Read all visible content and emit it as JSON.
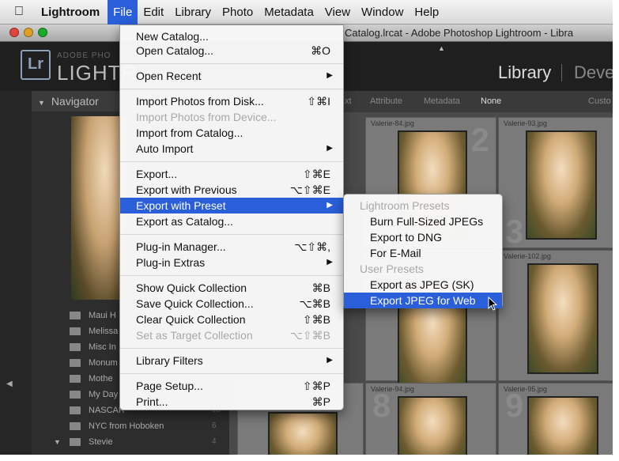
{
  "menubar": {
    "app": "Lightroom",
    "items": [
      "File",
      "Edit",
      "Library",
      "Photo",
      "Metadata",
      "View",
      "Window",
      "Help"
    ],
    "active": "File"
  },
  "window": {
    "title": "Catalog.lrcat - Adobe Photoshop Lightroom - Libra",
    "logo_text": "Lr",
    "adobe_text": "ADOBE PHO",
    "product_text": "LIGHTR",
    "modules": [
      "Library",
      "Deve"
    ]
  },
  "navigator": {
    "title": "Navigator"
  },
  "filterbar": {
    "items": [
      "xt",
      "Attribute",
      "Metadata",
      "None",
      "Custo"
    ]
  },
  "collections": [
    {
      "name": "Maui H",
      "count": ""
    },
    {
      "name": "Melissa",
      "count": ""
    },
    {
      "name": "Misc In",
      "count": ""
    },
    {
      "name": "Monum",
      "count": ""
    },
    {
      "name": "Mothe",
      "count": ""
    },
    {
      "name": "My Day",
      "count": ""
    },
    {
      "name": "NASCAR",
      "count": "15"
    },
    {
      "name": "NYC from Hoboken",
      "count": "6"
    },
    {
      "name": "Stevie",
      "count": "4"
    }
  ],
  "grid": {
    "labels": [
      "Valerie-84.jpg",
      "Valerie-93.jpg",
      "Valerie-102.jpg",
      "Valerie-94.jpg",
      "Valerie-95.jpg"
    ],
    "numbers": [
      "2",
      "3",
      "8",
      "9"
    ]
  },
  "file_menu": {
    "items": [
      {
        "label": "New Catalog...",
        "shortcut": ""
      },
      {
        "label": "Open Catalog...",
        "shortcut": "⌘O"
      },
      {
        "label": "Open Recent",
        "shortcut": ""
      },
      {
        "label": "Import Photos from Disk...",
        "shortcut": "⇧⌘I"
      },
      {
        "label": "Import Photos from Device...",
        "shortcut": ""
      },
      {
        "label": "Import from Catalog...",
        "shortcut": ""
      },
      {
        "label": "Auto Import",
        "shortcut": ""
      },
      {
        "label": "Export...",
        "shortcut": "⇧⌘E"
      },
      {
        "label": "Export with Previous",
        "shortcut": "⌥⇧⌘E"
      },
      {
        "label": "Export with Preset",
        "shortcut": ""
      },
      {
        "label": "Export as Catalog...",
        "shortcut": ""
      },
      {
        "label": "Plug-in Manager...",
        "shortcut": "⌥⇧⌘,"
      },
      {
        "label": "Plug-in Extras",
        "shortcut": ""
      },
      {
        "label": "Show Quick Collection",
        "shortcut": "⌘B"
      },
      {
        "label": "Save Quick Collection...",
        "shortcut": "⌥⌘B"
      },
      {
        "label": "Clear Quick Collection",
        "shortcut": "⇧⌘B"
      },
      {
        "label": "Set as Target Collection",
        "shortcut": "⌥⇧⌘B"
      },
      {
        "label": "Library Filters",
        "shortcut": ""
      },
      {
        "label": "Page Setup...",
        "shortcut": "⇧⌘P"
      },
      {
        "label": "Print...",
        "shortcut": "⌘P"
      }
    ]
  },
  "preset_menu": {
    "header_lightroom": "Lightroom Presets",
    "lightroom": [
      "Burn Full-Sized JPEGs",
      "Export to DNG",
      "For E-Mail"
    ],
    "header_user": "User Presets",
    "user": [
      "Export as JPEG (SK)",
      "Export JPEG for Web"
    ]
  },
  "colors": {
    "highlight": "#2a5fd9",
    "close": "#e0443e",
    "minimize": "#dea123",
    "zoom": "#1aab29"
  },
  "icons": {
    "apple": "apple-icon",
    "submenu": "chevron-right-icon",
    "pointer": "cursor-arrow-icon",
    "folder": "folder-icon"
  }
}
